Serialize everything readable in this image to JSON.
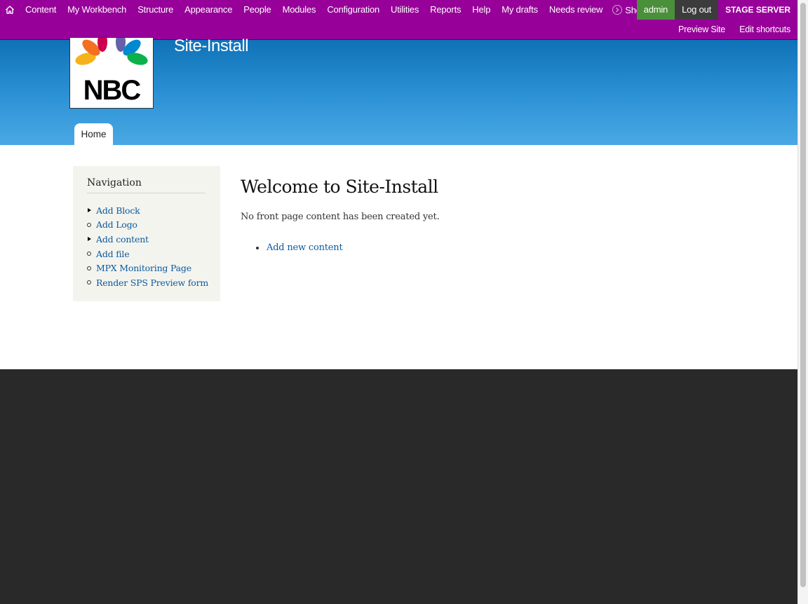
{
  "toolbar": {
    "home_icon": "home-icon",
    "menu": [
      "Content",
      "My Workbench",
      "Structure",
      "Appearance",
      "People",
      "Modules",
      "Configuration",
      "Utilities",
      "Reports",
      "Help",
      "My drafts",
      "Needs review"
    ],
    "shortcuts_label": "Shortcuts",
    "shortcuts_icon": "chevron-right-circle-icon",
    "user_name": "admin",
    "logout": "Log out",
    "server_label": "STAGE SERVER",
    "secondary": [
      "Preview Site",
      "Edit shortcuts"
    ]
  },
  "header": {
    "logo_text": "NBC",
    "site_name": "Site-Install",
    "tabs": [
      "Home"
    ]
  },
  "sidebar": {
    "title": "Navigation",
    "items": [
      {
        "label": "Add Block",
        "bullet": "triangle"
      },
      {
        "label": "Add Logo",
        "bullet": "circle"
      },
      {
        "label": "Add content",
        "bullet": "triangle"
      },
      {
        "label": "Add file",
        "bullet": "circle"
      },
      {
        "label": "MPX Monitoring Page",
        "bullet": "circle"
      },
      {
        "label": "Render SPS Preview form",
        "bullet": "circle"
      }
    ]
  },
  "main": {
    "title": "Welcome to Site-Install",
    "message": "No front page content has been created yet.",
    "links": [
      "Add new content"
    ]
  },
  "colors": {
    "toolbar": "#970099",
    "header_top": "#0f72b8",
    "header_bottom": "#4aa8e4",
    "footer": "#292929",
    "link": "#0b5a9e"
  }
}
